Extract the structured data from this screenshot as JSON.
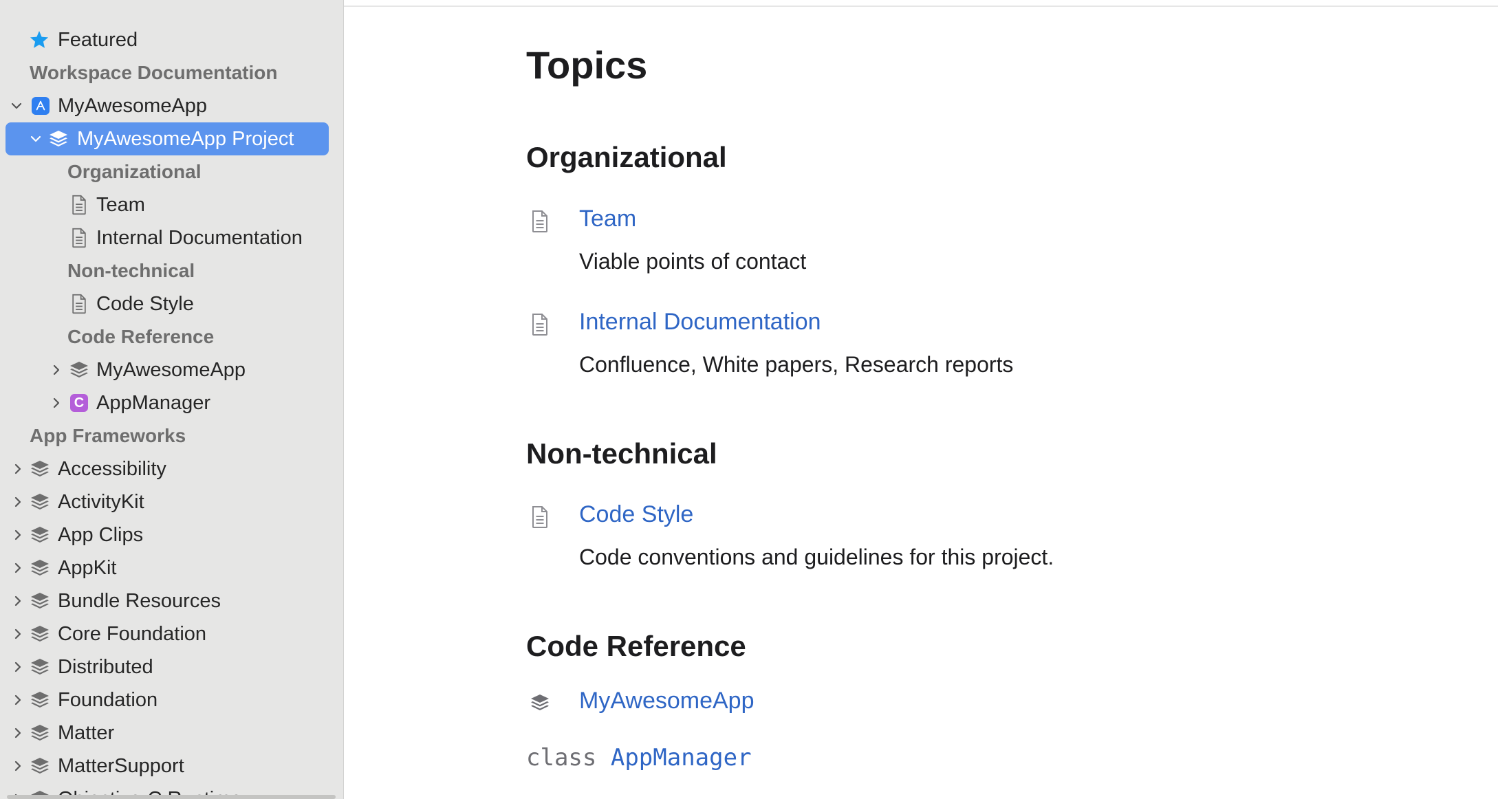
{
  "sidebar": {
    "items": [
      {
        "label": "Featured"
      },
      {
        "label": "Workspace Documentation"
      },
      {
        "label": "MyAwesomeApp"
      },
      {
        "label": "MyAwesomeApp Project"
      },
      {
        "label": "Organizational"
      },
      {
        "label": "Team"
      },
      {
        "label": "Internal Documentation"
      },
      {
        "label": "Non-technical"
      },
      {
        "label": "Code Style"
      },
      {
        "label": "Code Reference"
      },
      {
        "label": "MyAwesomeApp"
      },
      {
        "label": "AppManager",
        "badge": "C"
      },
      {
        "label": "App Frameworks"
      },
      {
        "label": "Accessibility"
      },
      {
        "label": "ActivityKit"
      },
      {
        "label": "App Clips"
      },
      {
        "label": "AppKit"
      },
      {
        "label": "Bundle Resources"
      },
      {
        "label": "Core Foundation"
      },
      {
        "label": "Distributed"
      },
      {
        "label": "Foundation"
      },
      {
        "label": "Matter"
      },
      {
        "label": "MatterSupport"
      },
      {
        "label": "Objective-C Runtime"
      }
    ]
  },
  "main": {
    "title": "Topics",
    "groups": [
      {
        "heading": "Organizational",
        "items": [
          {
            "title": "Team",
            "description": "Viable points of contact"
          },
          {
            "title": "Internal Documentation",
            "description": "Confluence, White papers, Research reports"
          }
        ]
      },
      {
        "heading": "Non-technical",
        "items": [
          {
            "title": "Code Style",
            "description": "Code conventions and guidelines for this project."
          }
        ]
      },
      {
        "heading": "Code Reference",
        "items": [
          {
            "title": "MyAwesomeApp"
          }
        ],
        "declaration": {
          "keyword": "class",
          "name": "AppManager"
        }
      }
    ]
  },
  "colors": {
    "sidebar_bg": "#e6e6e5",
    "selection": "#5b94ee",
    "link": "#2f66c5",
    "featured_star": "#1a9cf0",
    "class_badge": "#b45ed9"
  }
}
